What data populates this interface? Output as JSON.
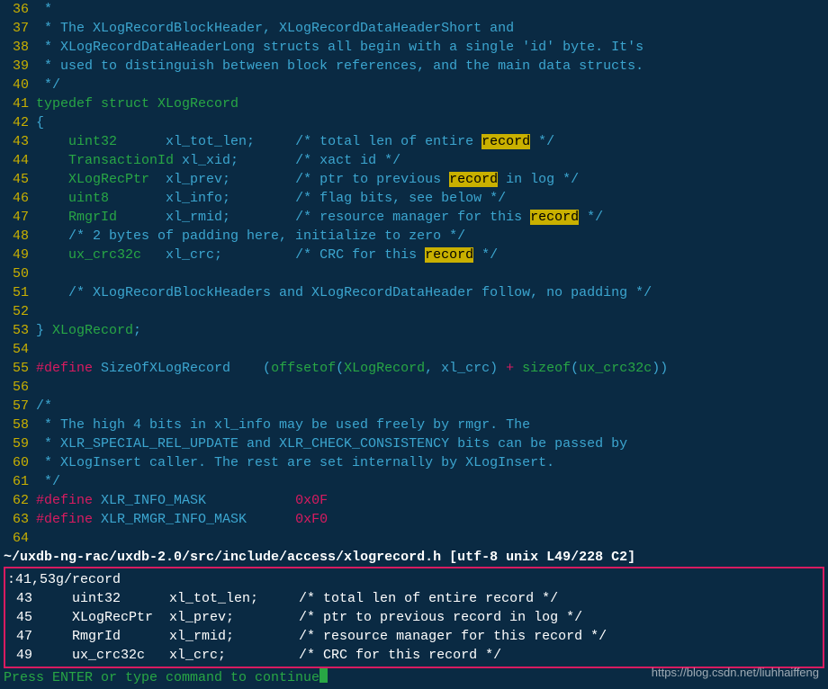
{
  "editor": {
    "lines": [
      {
        "n": "36",
        "segs": [
          {
            "cls": "cm",
            "t": " *"
          }
        ]
      },
      {
        "n": "37",
        "segs": [
          {
            "cls": "cm",
            "t": " * The XLogRecordBlockHeader, XLogRecordDataHeaderShort and"
          }
        ]
      },
      {
        "n": "38",
        "segs": [
          {
            "cls": "cm",
            "t": " * XLogRecordDataHeaderLong structs all begin with a single 'id' byte. It's"
          }
        ]
      },
      {
        "n": "39",
        "segs": [
          {
            "cls": "cm",
            "t": " * used to distinguish between block references, and the main data structs."
          }
        ]
      },
      {
        "n": "40",
        "segs": [
          {
            "cls": "cm",
            "t": " */"
          }
        ]
      },
      {
        "n": "41",
        "segs": [
          {
            "cls": "kw",
            "t": "typedef struct "
          },
          {
            "cls": "ty",
            "t": "XLogRecord"
          }
        ]
      },
      {
        "n": "42",
        "segs": [
          {
            "cls": "plain",
            "t": "{"
          }
        ]
      },
      {
        "n": "43",
        "segs": [
          {
            "cls": "plain",
            "t": "    "
          },
          {
            "cls": "ty",
            "t": "uint32"
          },
          {
            "cls": "plain",
            "t": "      xl_tot_len;     "
          },
          {
            "cls": "cm",
            "t": "/* total len of entire "
          },
          {
            "cls": "hl",
            "t": "record"
          },
          {
            "cls": "cm",
            "t": " */"
          }
        ]
      },
      {
        "n": "44",
        "segs": [
          {
            "cls": "plain",
            "t": "    "
          },
          {
            "cls": "ty",
            "t": "TransactionId"
          },
          {
            "cls": "plain",
            "t": " xl_xid;       "
          },
          {
            "cls": "cm",
            "t": "/* xact id */"
          }
        ]
      },
      {
        "n": "45",
        "segs": [
          {
            "cls": "plain",
            "t": "    "
          },
          {
            "cls": "ty",
            "t": "XLogRecPtr"
          },
          {
            "cls": "plain",
            "t": "  xl_prev;        "
          },
          {
            "cls": "cm",
            "t": "/* ptr to previous "
          },
          {
            "cls": "hl",
            "t": "record"
          },
          {
            "cls": "cm",
            "t": " in log */"
          }
        ]
      },
      {
        "n": "46",
        "segs": [
          {
            "cls": "plain",
            "t": "    "
          },
          {
            "cls": "ty",
            "t": "uint8"
          },
          {
            "cls": "plain",
            "t": "       xl_info;        "
          },
          {
            "cls": "cm",
            "t": "/* flag bits, see below */"
          }
        ]
      },
      {
        "n": "47",
        "segs": [
          {
            "cls": "plain",
            "t": "    "
          },
          {
            "cls": "ty",
            "t": "RmgrId"
          },
          {
            "cls": "plain",
            "t": "      xl_rmid;        "
          },
          {
            "cls": "cm",
            "t": "/* resource manager for this "
          },
          {
            "cls": "hl",
            "t": "record"
          },
          {
            "cls": "cm",
            "t": " */"
          }
        ]
      },
      {
        "n": "48",
        "segs": [
          {
            "cls": "plain",
            "t": "    "
          },
          {
            "cls": "cm",
            "t": "/* 2 bytes of padding here, initialize to zero */"
          }
        ]
      },
      {
        "n": "49",
        "segs": [
          {
            "cls": "plain",
            "t": "    "
          },
          {
            "cls": "ty",
            "t": "ux_crc32c"
          },
          {
            "cls": "plain",
            "t": "   xl_crc;         "
          },
          {
            "cls": "cm",
            "t": "/* CRC for this "
          },
          {
            "cls": "hl",
            "t": "record"
          },
          {
            "cls": "cm",
            "t": " */"
          }
        ]
      },
      {
        "n": "50",
        "segs": [
          {
            "cls": "plain",
            "t": ""
          }
        ]
      },
      {
        "n": "51",
        "segs": [
          {
            "cls": "plain",
            "t": "    "
          },
          {
            "cls": "cm",
            "t": "/* XLogRecordBlockHeaders and XLogRecordDataHeader follow, no padding */"
          }
        ]
      },
      {
        "n": "52",
        "segs": [
          {
            "cls": "plain",
            "t": ""
          }
        ]
      },
      {
        "n": "53",
        "segs": [
          {
            "cls": "plain",
            "t": "} "
          },
          {
            "cls": "ty",
            "t": "XLogRecord"
          },
          {
            "cls": "plain",
            "t": ";"
          }
        ]
      },
      {
        "n": "54",
        "segs": [
          {
            "cls": "plain",
            "t": ""
          }
        ]
      },
      {
        "n": "55",
        "segs": [
          {
            "cls": "def",
            "t": "#define "
          },
          {
            "cls": "defname",
            "t": "SizeOfXLogRecord"
          },
          {
            "cls": "plain",
            "t": "    ("
          },
          {
            "cls": "fn",
            "t": "offsetof"
          },
          {
            "cls": "plain",
            "t": "("
          },
          {
            "cls": "ty",
            "t": "XLogRecord"
          },
          {
            "cls": "plain",
            "t": ", xl_crc) "
          },
          {
            "cls": "num",
            "t": "+"
          },
          {
            "cls": "plain",
            "t": " "
          },
          {
            "cls": "fn",
            "t": "sizeof"
          },
          {
            "cls": "plain",
            "t": "("
          },
          {
            "cls": "ty",
            "t": "ux_crc32c"
          },
          {
            "cls": "plain",
            "t": "))"
          }
        ]
      },
      {
        "n": "56",
        "segs": [
          {
            "cls": "plain",
            "t": ""
          }
        ]
      },
      {
        "n": "57",
        "segs": [
          {
            "cls": "cm",
            "t": "/*"
          }
        ]
      },
      {
        "n": "58",
        "segs": [
          {
            "cls": "cm",
            "t": " * The high 4 bits in xl_info may be used freely by rmgr. The"
          }
        ]
      },
      {
        "n": "59",
        "segs": [
          {
            "cls": "cm",
            "t": " * XLR_SPECIAL_REL_UPDATE and XLR_CHECK_CONSISTENCY bits can be passed by"
          }
        ]
      },
      {
        "n": "60",
        "segs": [
          {
            "cls": "cm",
            "t": " * XLogInsert caller. The rest are set internally by XLogInsert."
          }
        ]
      },
      {
        "n": "61",
        "segs": [
          {
            "cls": "cm",
            "t": " */"
          }
        ]
      },
      {
        "n": "62",
        "segs": [
          {
            "cls": "def",
            "t": "#define "
          },
          {
            "cls": "defname",
            "t": "XLR_INFO_MASK"
          },
          {
            "cls": "plain",
            "t": "           "
          },
          {
            "cls": "num",
            "t": "0x0F"
          }
        ]
      },
      {
        "n": "63",
        "segs": [
          {
            "cls": "def",
            "t": "#define "
          },
          {
            "cls": "defname",
            "t": "XLR_RMGR_INFO_MASK"
          },
          {
            "cls": "plain",
            "t": "      "
          },
          {
            "cls": "num",
            "t": "0xF0"
          }
        ]
      },
      {
        "n": "64",
        "segs": [
          {
            "cls": "plain",
            "t": ""
          }
        ]
      }
    ]
  },
  "statusline": "~/uxdb-ng-rac/uxdb-2.0/src/include/access/xlogrecord.h [utf-8 unix L49/228 C2]",
  "results": {
    "command": ":41,53g/record",
    "rows": [
      {
        "n": "43",
        "t": "    uint32      xl_tot_len;     /* total len of entire record */"
      },
      {
        "n": "45",
        "t": "    XLogRecPtr  xl_prev;        /* ptr to previous record in log */"
      },
      {
        "n": "47",
        "t": "    RmgrId      xl_rmid;        /* resource manager for this record */"
      },
      {
        "n": "49",
        "t": "    ux_crc32c   xl_crc;         /* CRC for this record */"
      }
    ]
  },
  "prompt": "Press ENTER or type command to continue",
  "watermark": "https://blog.csdn.net/liuhhaiffeng"
}
